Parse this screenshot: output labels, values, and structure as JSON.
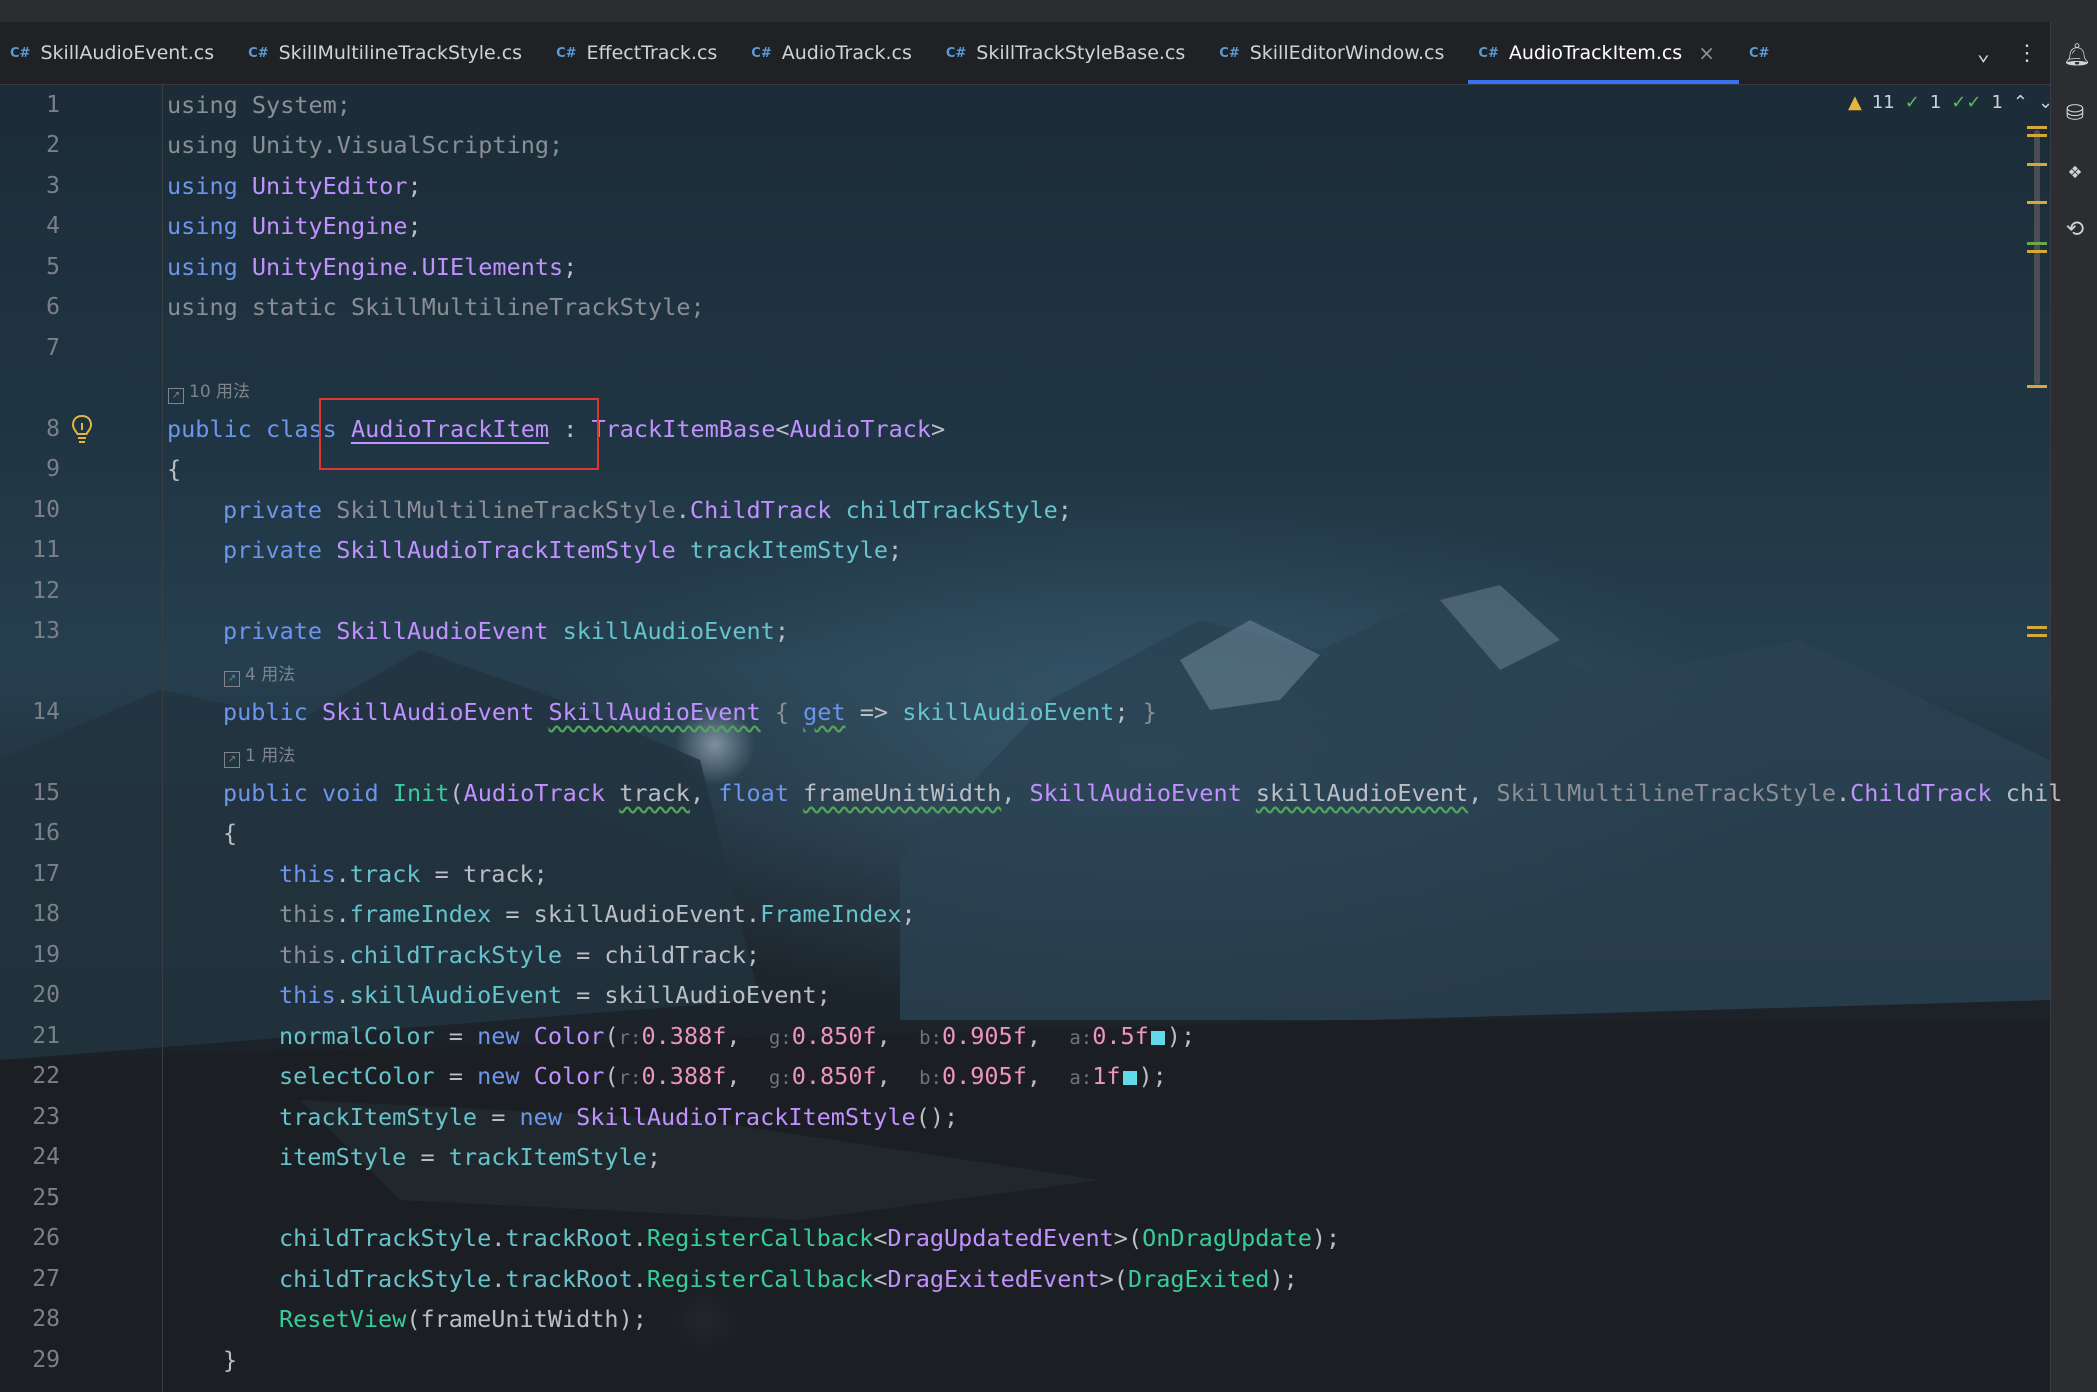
{
  "tabs": [
    {
      "label": "SkillAudioEvent.cs",
      "active": false
    },
    {
      "label": "SkillMultilineTrackStyle.cs",
      "active": false
    },
    {
      "label": "EffectTrack.cs",
      "active": false
    },
    {
      "label": "AudioTrack.cs",
      "active": false
    },
    {
      "label": "SkillTrackStyleBase.cs",
      "active": false
    },
    {
      "label": "SkillEditorWindow.cs",
      "active": false
    },
    {
      "label": "AudioTrackItem.cs",
      "active": true
    }
  ],
  "tab_icon": "C#",
  "inspection": {
    "warnings": "11",
    "weak": "1",
    "typos": "1"
  },
  "usage_hints": {
    "class": "10 用法",
    "property": "4 用法",
    "init": "1 用法"
  },
  "colors": {
    "accent": "#3574f0",
    "selection_box": "#e03535",
    "swatch": "#63d9e7"
  },
  "line_numbers": [
    "1",
    "2",
    "3",
    "4",
    "5",
    "6",
    "7",
    "8",
    "9",
    "10",
    "11",
    "12",
    "13",
    "14",
    "15",
    "16",
    "17",
    "18",
    "19",
    "20",
    "21",
    "22",
    "23",
    "24",
    "25",
    "26",
    "27",
    "28",
    "29"
  ],
  "code": {
    "l1": [
      "using",
      "System",
      ";"
    ],
    "l2": [
      "using",
      "Unity.VisualScripting",
      ";"
    ],
    "l3": [
      "using",
      "UnityEditor",
      ";"
    ],
    "l4": [
      "using",
      "UnityEngine",
      ";"
    ],
    "l5": [
      "using",
      "UnityEngine.UIElements",
      ";"
    ],
    "l6": [
      "using static",
      "SkillMultilineTrackStyle",
      ";"
    ],
    "l8": [
      "public class",
      "AudioTrackItem",
      " : ",
      "TrackItemBase",
      "<",
      "AudioTrack",
      ">"
    ],
    "l9": "{",
    "l10": [
      "private",
      "SkillMultilineTrackStyle",
      ".",
      "ChildTrack",
      "childTrackStyle",
      ";"
    ],
    "l11": [
      "private",
      "SkillAudioTrackItemStyle",
      "trackItemStyle",
      ";"
    ],
    "l13": [
      "private",
      "SkillAudioEvent",
      "skillAudioEvent",
      ";"
    ],
    "l14": [
      "public",
      "SkillAudioEvent",
      "SkillAudioEvent",
      "{",
      "get",
      "=>",
      "skillAudioEvent",
      ";",
      "}"
    ],
    "l15": [
      "public void",
      "Init",
      "(",
      "AudioTrack",
      "track",
      ", ",
      "float",
      "frameUnitWidth",
      ", ",
      "SkillAudioEvent",
      "skillAudioEvent",
      ", ",
      "SkillMultilineTrackStyle",
      ".",
      "ChildTrack",
      "chil"
    ],
    "l16": "{",
    "l17": [
      "this",
      ".",
      "track",
      " = track;"
    ],
    "l18": [
      "this",
      ".",
      "frameIndex",
      " = skillAudioEvent.",
      "FrameIndex",
      ";"
    ],
    "l19": [
      "this",
      ".",
      "childTrackStyle",
      " = childTrack;"
    ],
    "l20": [
      "this",
      ".",
      "skillAudioEvent",
      " = skillAudioEvent;"
    ],
    "l21": [
      "normalColor",
      " = ",
      "new",
      "Color",
      "(",
      "r:",
      "0.388f",
      ", ",
      "g:",
      "0.850f",
      ", ",
      "b:",
      "0.905f",
      ", ",
      "a:",
      "0.5f",
      ");"
    ],
    "l22": [
      "selectColor",
      " = ",
      "new",
      "Color",
      "(",
      "r:",
      "0.388f",
      ", ",
      "g:",
      "0.850f",
      ", ",
      "b:",
      "0.905f",
      ", ",
      "a:",
      "1f",
      ");"
    ],
    "l23": [
      "trackItemStyle",
      " = ",
      "new",
      "SkillAudioTrackItemStyle",
      "();"
    ],
    "l24": [
      "itemStyle",
      " = ",
      "trackItemStyle",
      ";"
    ],
    "l26": [
      "childTrackStyle",
      ".",
      "trackRoot",
      ".",
      "RegisterCallback",
      "<",
      "DragUpdatedEvent",
      ">(",
      "OnDragUpdate",
      ");"
    ],
    "l27": [
      "childTrackStyle",
      ".",
      "trackRoot",
      ".",
      "RegisterCallback",
      "<",
      "DragExitedEvent",
      ">(",
      "DragExited",
      ");"
    ],
    "l28": [
      "ResetView",
      "(frameUnitWidth);"
    ],
    "l29": "}"
  }
}
